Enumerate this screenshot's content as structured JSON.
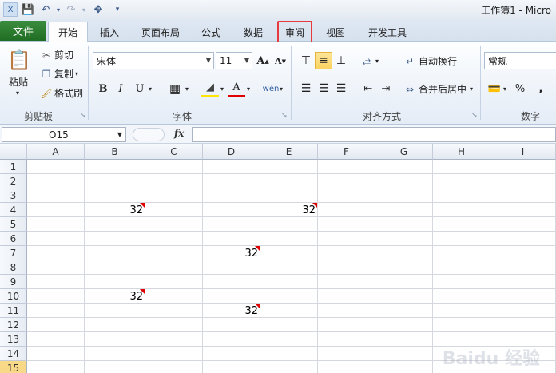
{
  "window": {
    "title": "工作簿1 - Micro"
  },
  "quick_access": [
    {
      "icon": "save-icon"
    },
    {
      "icon": "undo-icon"
    },
    {
      "icon": "redo-icon"
    },
    {
      "icon": "tools-icon"
    }
  ],
  "tabs": {
    "file": "文件",
    "items": [
      "开始",
      "插入",
      "页面布局",
      "公式",
      "数据",
      "审阅",
      "视图",
      "开发工具"
    ],
    "active": "开始",
    "highlighted": "审阅"
  },
  "ribbon": {
    "clipboard": {
      "paste": "粘贴",
      "cut": "剪切",
      "copy": "复制",
      "format_painter": "格式刷",
      "label": "剪贴板"
    },
    "font": {
      "name": "宋体",
      "size": "11",
      "label": "字体"
    },
    "alignment": {
      "wrap": "自动换行",
      "merge": "合并后居中",
      "label": "对齐方式"
    },
    "number": {
      "format": "常规",
      "percent": "%",
      "comma": ",",
      "label": "数字"
    }
  },
  "formula_bar": {
    "cell_ref": "O15",
    "fx": "fx",
    "value": ""
  },
  "sheet": {
    "columns": [
      "A",
      "B",
      "C",
      "D",
      "E",
      "F",
      "G",
      "H",
      "I"
    ],
    "rows": [
      "1",
      "2",
      "3",
      "4",
      "5",
      "6",
      "7",
      "8",
      "9",
      "10",
      "11",
      "12",
      "13",
      "14",
      "15"
    ],
    "selected_row": "15",
    "cells": [
      {
        "row": 4,
        "col": "B",
        "value": "32",
        "comment": true
      },
      {
        "row": 4,
        "col": "E",
        "value": "32",
        "comment": true
      },
      {
        "row": 7,
        "col": "D",
        "value": "32",
        "comment": true
      },
      {
        "row": 10,
        "col": "B",
        "value": "32",
        "comment": true
      },
      {
        "row": 11,
        "col": "D",
        "value": "32",
        "comment": true
      }
    ]
  },
  "watermark": "Baidu 经验"
}
